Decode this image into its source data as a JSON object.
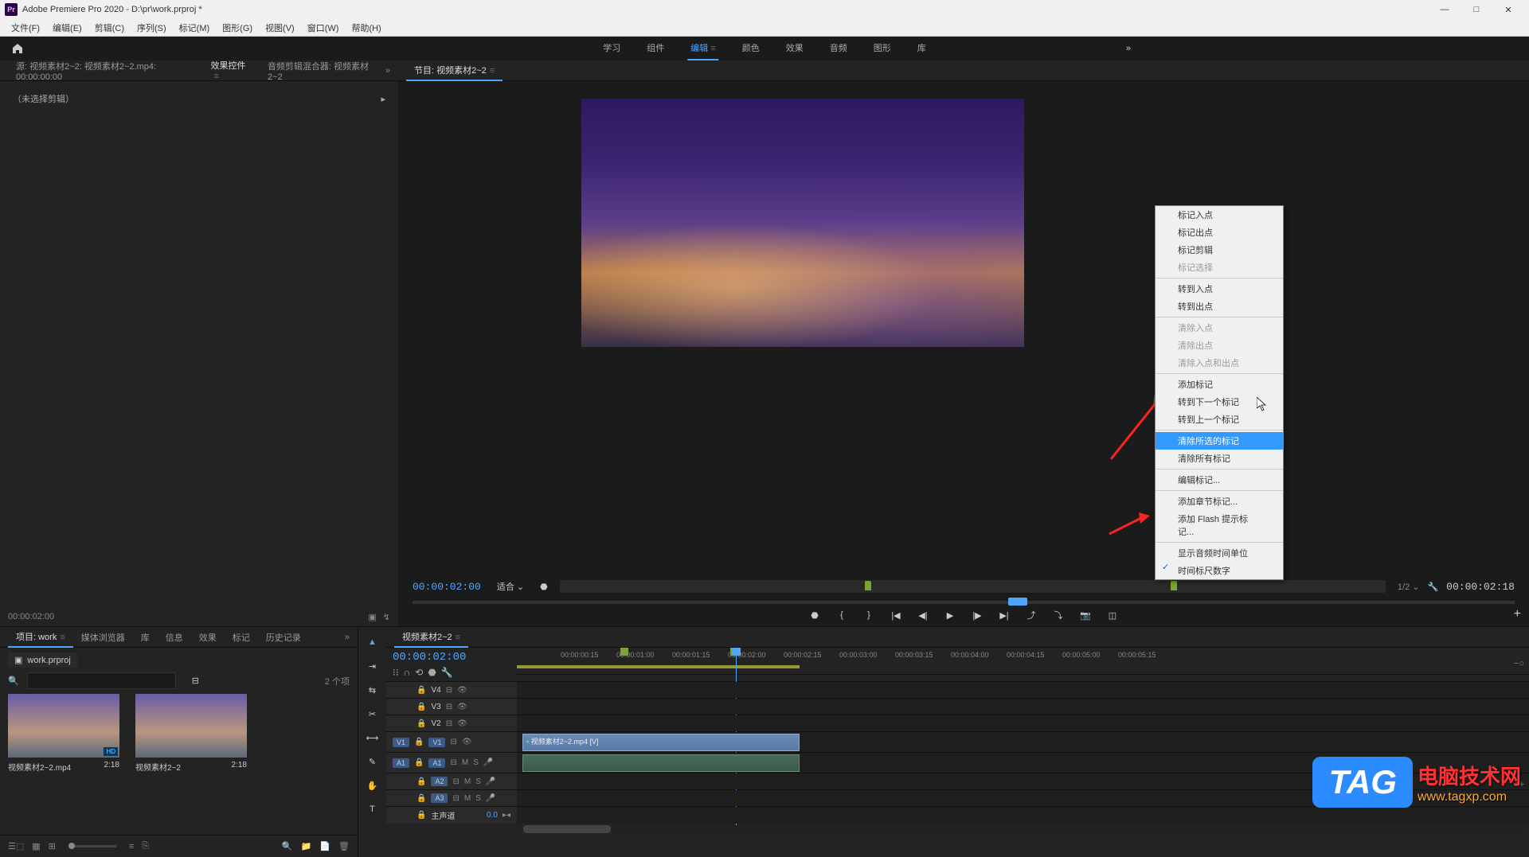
{
  "titlebar": {
    "app": "Adobe Premiere Pro 2020",
    "project": "D:\\pr\\work.prproj *"
  },
  "menubar": [
    "文件(F)",
    "编辑(E)",
    "剪辑(C)",
    "序列(S)",
    "标记(M)",
    "图形(G)",
    "视图(V)",
    "窗口(W)",
    "帮助(H)"
  ],
  "workspace_tabs": [
    "学习",
    "组件",
    "编辑",
    "颜色",
    "效果",
    "音频",
    "图形",
    "库"
  ],
  "workspace_active": "编辑",
  "source_tabs": [
    {
      "label": "源: 视频素材2~2: 视频素材2~2.mp4: 00:00:00:00",
      "active": false
    },
    {
      "label": "效果控件",
      "active": true
    },
    {
      "label": "音频剪辑混合器: 视频素材2~2",
      "active": false
    }
  ],
  "source_empty": "（未选择剪辑）",
  "source_tc": "00:00:02:00",
  "program_tab": "节目: 视频素材2~2",
  "program_tc_left": "00:00:02:00",
  "program_fit": "适合",
  "program_ratio": "1/2",
  "program_tc_right": "00:00:02:18",
  "context_menu": {
    "items": [
      {
        "label": "标记入点",
        "type": "item"
      },
      {
        "label": "标记出点",
        "type": "item"
      },
      {
        "label": "标记剪辑",
        "type": "item"
      },
      {
        "label": "标记选择",
        "type": "disabled"
      },
      {
        "type": "sep"
      },
      {
        "label": "转到入点",
        "type": "item"
      },
      {
        "label": "转到出点",
        "type": "item"
      },
      {
        "type": "sep"
      },
      {
        "label": "清除入点",
        "type": "disabled"
      },
      {
        "label": "清除出点",
        "type": "disabled"
      },
      {
        "label": "清除入点和出点",
        "type": "disabled"
      },
      {
        "type": "sep"
      },
      {
        "label": "添加标记",
        "type": "item"
      },
      {
        "label": "转到下一个标记",
        "type": "item"
      },
      {
        "label": "转到上一个标记",
        "type": "item"
      },
      {
        "type": "sep"
      },
      {
        "label": "清除所选的标记",
        "type": "hl"
      },
      {
        "label": "清除所有标记",
        "type": "item"
      },
      {
        "type": "sep"
      },
      {
        "label": "编辑标记...",
        "type": "item"
      },
      {
        "type": "sep"
      },
      {
        "label": "添加章节标记...",
        "type": "item"
      },
      {
        "label": "添加 Flash 提示标记...",
        "type": "item"
      },
      {
        "type": "sep"
      },
      {
        "label": "显示音频时间单位",
        "type": "item"
      },
      {
        "label": "时间标尺数字",
        "type": "checked"
      }
    ]
  },
  "project": {
    "tabs": [
      {
        "label": "项目: work",
        "active": true
      },
      {
        "label": "媒体浏览器",
        "active": false
      },
      {
        "label": "库",
        "active": false
      },
      {
        "label": "信息",
        "active": false
      },
      {
        "label": "效果",
        "active": false
      },
      {
        "label": "标记",
        "active": false
      },
      {
        "label": "历史记录",
        "active": false
      }
    ],
    "filename": "work.prproj",
    "count": "2 个项",
    "items": [
      {
        "name": "视频素材2~2.mp4",
        "dur": "2:18",
        "badge": true
      },
      {
        "name": "视频素材2~2",
        "dur": "2:18",
        "badge": false
      }
    ]
  },
  "timeline": {
    "tab": "视频素材2~2",
    "tc": "00:00:02:00",
    "ticks": [
      "00:00:00:15",
      "00:00:01:00",
      "00:00:01:15",
      "00:00:02:00",
      "00:00:02:15",
      "00:00:03:00",
      "00:00:03:15",
      "00:00:04:00",
      "00:00:04:15",
      "00:00:05:00",
      "00:00:05:15"
    ],
    "tracks_v": [
      "V4",
      "V3",
      "V2",
      "V1"
    ],
    "tracks_a": [
      "A1",
      "A2",
      "A3"
    ],
    "master": "主声道",
    "master_val": "0.0",
    "clip_name": "视频素材2~2.mp4 [V]",
    "targets": {
      "v": "V1",
      "a": "A1"
    }
  },
  "watermark": {
    "tag": "TAG",
    "t1": "电脑技术网",
    "t2": "www.tagxp.com"
  }
}
